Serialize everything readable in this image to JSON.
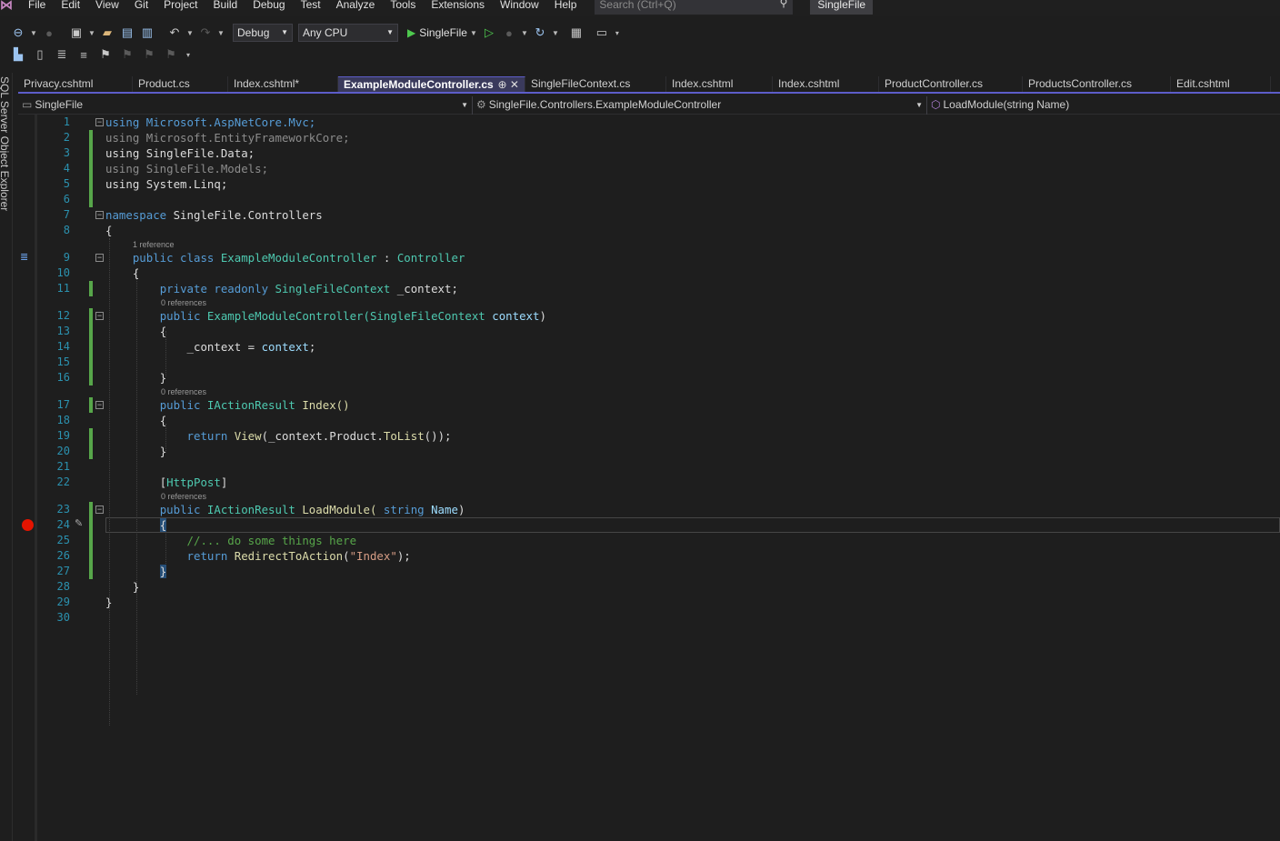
{
  "menu": {
    "items": [
      "File",
      "Edit",
      "View",
      "Git",
      "Project",
      "Build",
      "Debug",
      "Test",
      "Analyze",
      "Tools",
      "Extensions",
      "Window",
      "Help"
    ],
    "search_placeholder": "Search (Ctrl+Q)",
    "solution_name": "SingleFile"
  },
  "toolbar": {
    "configuration": "Debug",
    "platform": "Any CPU",
    "run_target": "SingleFile"
  },
  "sidebar": {
    "label": "SQL Server Object Explorer"
  },
  "tabs": [
    {
      "label": "Privacy.cshtml",
      "active": false
    },
    {
      "label": "Product.cs",
      "active": false
    },
    {
      "label": "Index.cshtml*",
      "active": false
    },
    {
      "label": "ExampleModuleController.cs",
      "active": true
    },
    {
      "label": "SingleFileContext.cs",
      "active": false
    },
    {
      "label": "Index.cshtml",
      "active": false
    },
    {
      "label": "Index.cshtml",
      "active": false
    },
    {
      "label": "ProductController.cs",
      "active": false
    },
    {
      "label": "ProductsController.cs",
      "active": false
    },
    {
      "label": "Edit.cshtml",
      "active": false
    }
  ],
  "tab_active_icons": "⊕ ✕",
  "navigation": {
    "project": "SingleFile",
    "type": "SingleFile.Controllers.ExampleModuleController",
    "member": "LoadModule(string Name)"
  },
  "codelens": {
    "class_refs": "1 reference",
    "field_refs": "0 references",
    "index_refs": "0 references",
    "load_refs": "0 references"
  },
  "code_lines": {
    "l1": "using Microsoft.AspNetCore.Mvc;",
    "l2": "using Microsoft.EntityFrameworkCore;",
    "l3": "using SingleFile.Data;",
    "l4": "using SingleFile.Models;",
    "l5": "using System.Linq;",
    "l7_kw": "namespace",
    "l7_name": " SingleFile.Controllers",
    "l8": "{",
    "l9_kw": "public class",
    "l9_name": " ExampleModuleController",
    "l9_sep": " : ",
    "l9_base": "Controller",
    "l10": "{",
    "l11_kw": "private readonly",
    "l11_type": " SingleFileContext",
    "l11_rest": " _context;",
    "l12_kw": "public",
    "l12_name": " ExampleModuleController(",
    "l12_type": "SingleFileContext",
    "l12_param": " context",
    "l12_end": ")",
    "l13": "{",
    "l14_a": "_context = ",
    "l14_b": "context",
    "l14_c": ";",
    "l16": "}",
    "l17_kw": "public",
    "l17_type": " IActionResult",
    "l17_name": " Index()",
    "l18": "{",
    "l19_kw": "return",
    "l19_m": " View",
    "l19_rest": "(_context.Product.",
    "l19_m2": "ToList",
    "l19_end": "());",
    "l20": "}",
    "l22_a": "[",
    "l22_attr": "HttpPost",
    "l22_b": "]",
    "l23_kw": "public",
    "l23_type": " IActionResult",
    "l23_name": " LoadModule(",
    "l23_kw2": " string",
    "l23_param": " Name",
    "l23_end": ")",
    "l24": "{",
    "l25": "//... do some things here",
    "l26_kw": "return",
    "l26_m": " RedirectToAction",
    "l26_a": "(",
    "l26_str": "\"Index\"",
    "l26_b": ");",
    "l27": "}",
    "l28": "}",
    "l29": "}"
  },
  "line_numbers": [
    "1",
    "2",
    "3",
    "4",
    "5",
    "6",
    "7",
    "8",
    "9",
    "10",
    "11",
    "12",
    "13",
    "14",
    "15",
    "16",
    "17",
    "18",
    "19",
    "20",
    "21",
    "22",
    "23",
    "24",
    "25",
    "26",
    "27",
    "28",
    "29",
    "30"
  ],
  "colors": {
    "keyword": "#569cd6",
    "type": "#4ec9b0",
    "string": "#d69d85",
    "comment": "#57a64a",
    "line_number": "#2b91af",
    "change_bar": "#57a64a",
    "breakpoint": "#e51400"
  },
  "breakpoint_line": "24"
}
